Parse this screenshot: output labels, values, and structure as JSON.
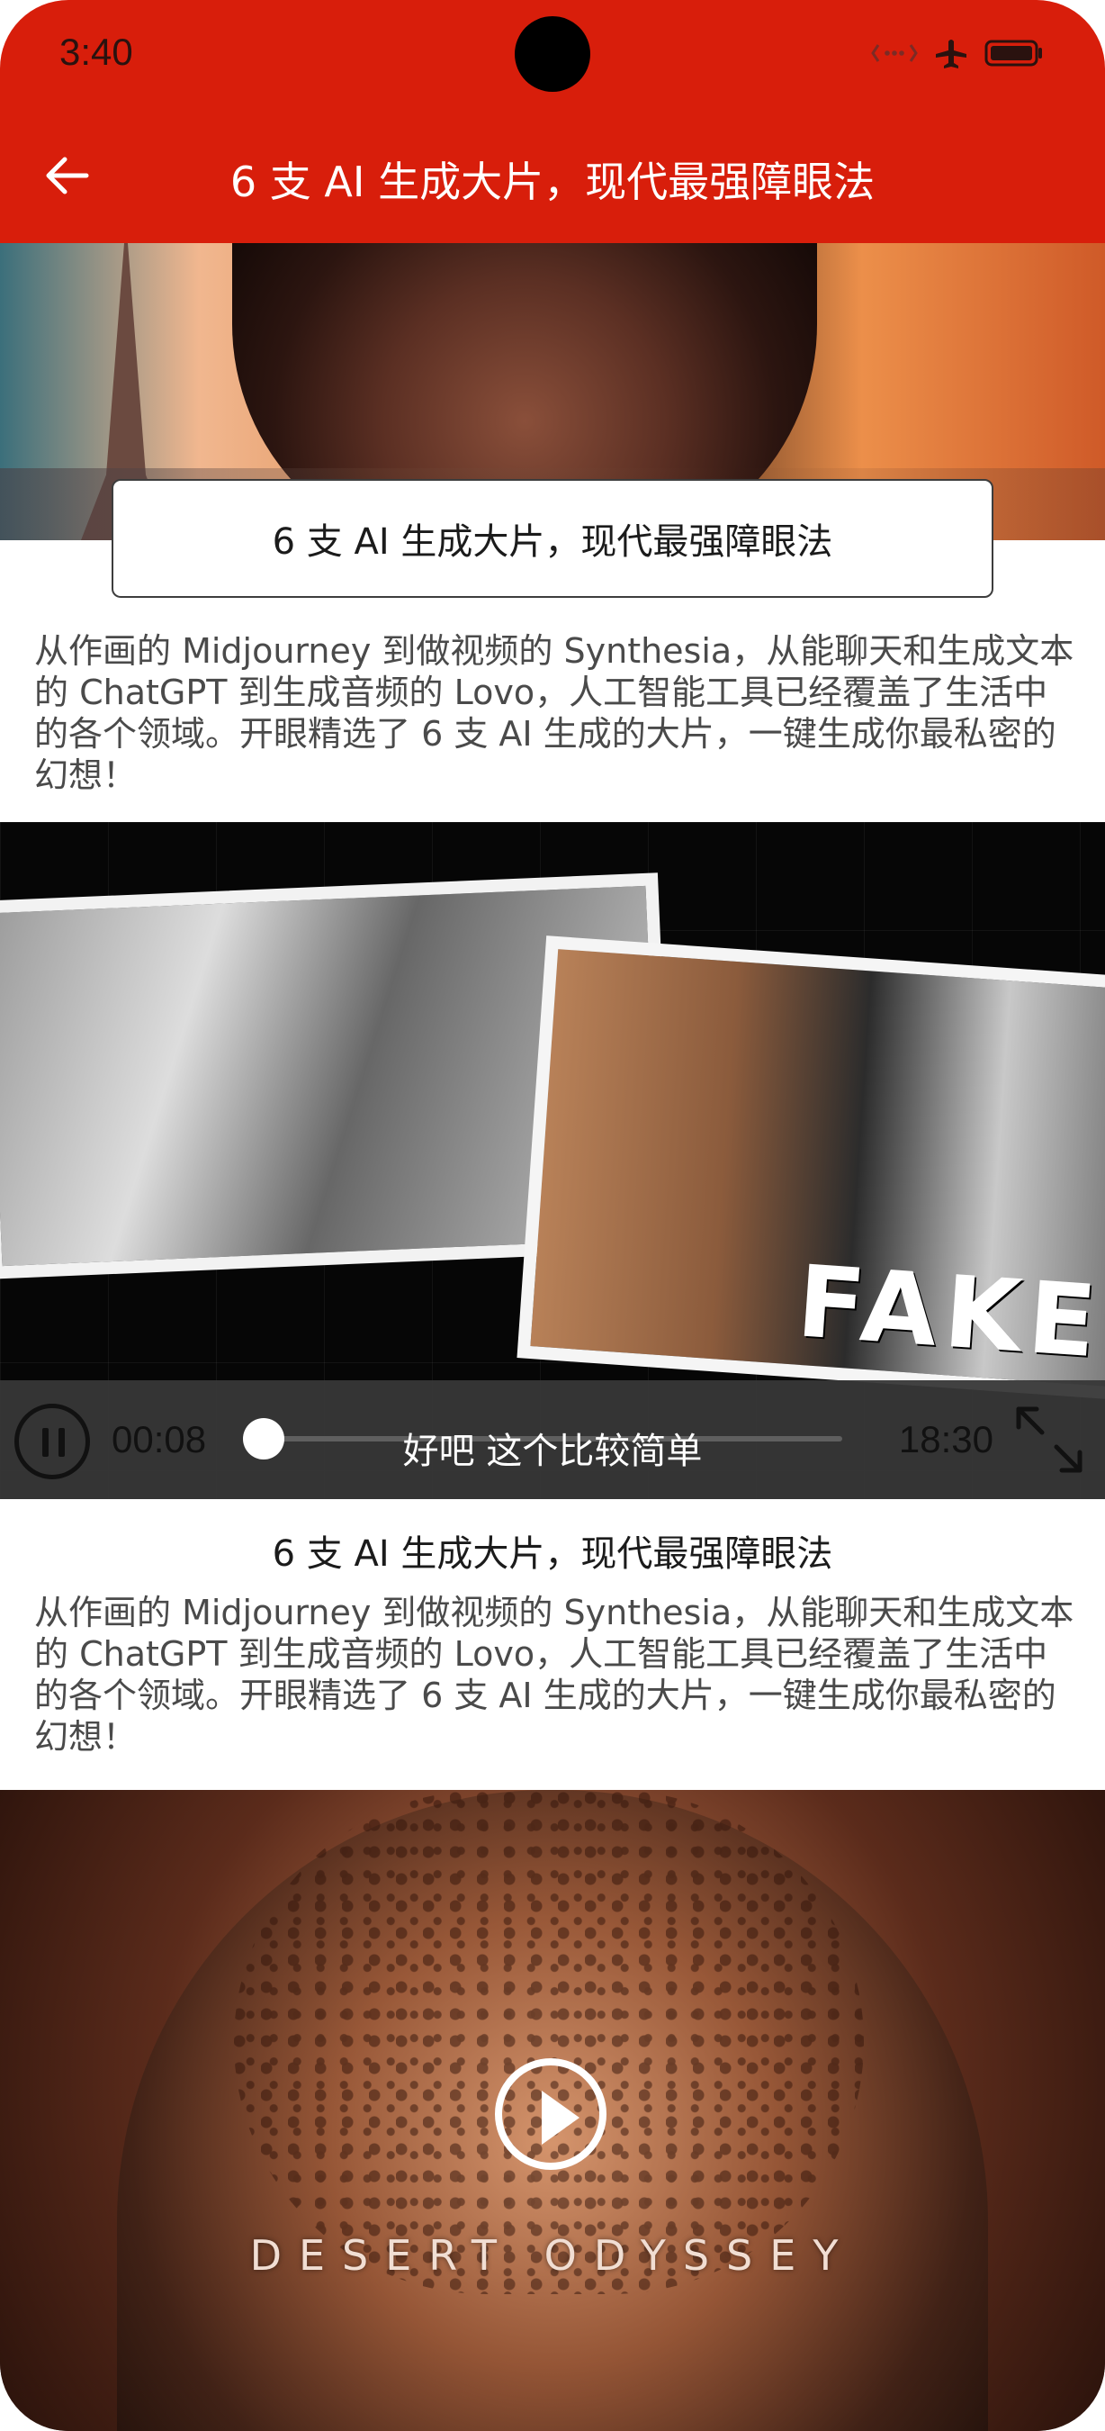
{
  "status_bar": {
    "time": "3:40"
  },
  "app_bar": {
    "title": "6 支 AI 生成大片，现代最强障眼法",
    "back_icon": "arrow-left-icon"
  },
  "hero": {
    "card_title": "6 支 AI 生成大片，现代最强障眼法",
    "description": "从作画的 Midjourney 到做视频的 Synthesia，从能聊天和生成文本的 ChatGPT 到生成音频的 Lovo，人工智能工具已经覆盖了生活中的各个领域。开眼精选了 6 支 AI 生成的大片，一键生成你最私密的幻想！"
  },
  "video_card": {
    "current_time": "00:08",
    "duration": "18:30",
    "subtitle": "好吧 这个比较简单",
    "progress": 0.01,
    "overlay_text": "FAKE"
  },
  "section": {
    "title": "6 支 AI 生成大片，现代最强障眼法",
    "description": "从作画的 Midjourney 到做视频的 Synthesia，从能聊天和生成文本的 ChatGPT 到生成音频的 Lovo，人工智能工具已经覆盖了生活中的各个领域。开眼精选了 6 支 AI 生成的大片，一键生成你最私密的幻想！"
  },
  "poster": {
    "title": "DESERT ODYSSEY",
    "play_icon": "play-icon"
  }
}
